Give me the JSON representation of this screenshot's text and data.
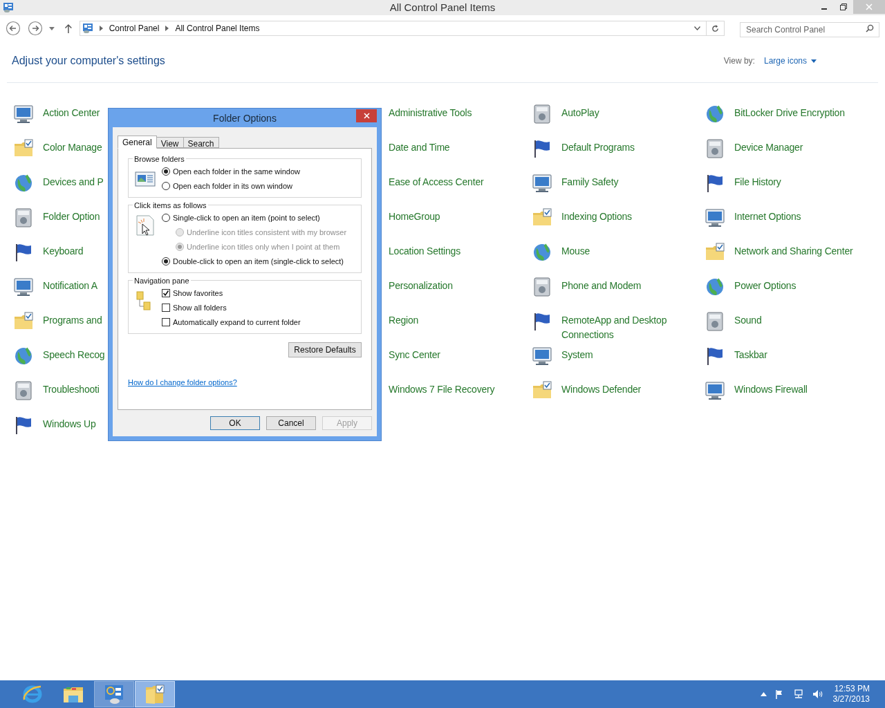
{
  "window": {
    "title": "All Control Panel Items"
  },
  "breadcrumb": [
    "Control Panel",
    "All Control Panel Items"
  ],
  "search": {
    "placeholder": "Search Control Panel"
  },
  "heading": "Adjust your computer's settings",
  "view_by": {
    "label": "View by:",
    "value": "Large icons"
  },
  "items": [
    {
      "label": "Action Center"
    },
    {
      "label": "Administrative Tools"
    },
    {
      "label": "AutoPlay"
    },
    {
      "label": "BitLocker Drive Encryption"
    },
    {
      "label": "Color Manage"
    },
    {
      "label": "Date and Time"
    },
    {
      "label": "Default Programs"
    },
    {
      "label": "Device Manager"
    },
    {
      "label": "Devices and P"
    },
    {
      "label": "Ease of Access Center"
    },
    {
      "label": "Family Safety"
    },
    {
      "label": "File History"
    },
    {
      "label": "Folder Option"
    },
    {
      "label": "HomeGroup"
    },
    {
      "label": "Indexing Options"
    },
    {
      "label": "Internet Options"
    },
    {
      "label": "Keyboard"
    },
    {
      "label": "Location Settings"
    },
    {
      "label": "Mouse"
    },
    {
      "label": "Network and Sharing Center"
    },
    {
      "label": "Notification A"
    },
    {
      "label": "Personalization"
    },
    {
      "label": "Phone and Modem"
    },
    {
      "label": "Power Options"
    },
    {
      "label": "Programs and"
    },
    {
      "label": "Region"
    },
    {
      "label": "RemoteApp and Desktop Connections"
    },
    {
      "label": "Sound"
    },
    {
      "label": "Speech Recog"
    },
    {
      "label": "Sync Center"
    },
    {
      "label": "System"
    },
    {
      "label": "Taskbar"
    },
    {
      "label": "Troubleshooti"
    },
    {
      "label": "Windows 7 File Recovery"
    },
    {
      "label": "Windows Defender"
    },
    {
      "label": "Windows Firewall"
    },
    {
      "label": "Windows Up"
    }
  ],
  "dialog": {
    "title": "Folder Options",
    "tabs": [
      {
        "label": "General",
        "selected": true
      },
      {
        "label": "View",
        "selected": false
      },
      {
        "label": "Search",
        "selected": false
      }
    ],
    "browse_folders": {
      "title": "Browse folders",
      "options": [
        {
          "label": "Open each folder in the same window",
          "selected": true,
          "disabled": false
        },
        {
          "label": "Open each folder in its own window",
          "selected": false,
          "disabled": false
        }
      ]
    },
    "click_items": {
      "title": "Click items as follows",
      "options": [
        {
          "label": "Single-click to open an item (point to select)",
          "selected": false,
          "disabled": false,
          "children": [
            {
              "label": "Underline icon titles consistent with my browser",
              "selected": false,
              "disabled": true
            },
            {
              "label": "Underline icon titles only when I point at them",
              "selected": true,
              "disabled": true
            }
          ]
        },
        {
          "label": "Double-click to open an item (single-click to select)",
          "selected": true,
          "disabled": false
        }
      ]
    },
    "navigation_pane": {
      "title": "Navigation pane",
      "options": [
        {
          "label": "Show favorites",
          "checked": true
        },
        {
          "label": "Show all folders",
          "checked": false
        },
        {
          "label": "Automatically expand to current folder",
          "checked": false
        }
      ]
    },
    "restore_button": "Restore Defaults",
    "help_link": "How do I change folder options?",
    "buttons": [
      {
        "label": "OK",
        "disabled": false,
        "default": true
      },
      {
        "label": "Cancel",
        "disabled": false,
        "default": false
      },
      {
        "label": "Apply",
        "disabled": true,
        "default": false
      }
    ]
  },
  "taskbar": {
    "apps": [
      {
        "kind": "browser",
        "active": false
      },
      {
        "kind": "explorer",
        "active": false
      },
      {
        "kind": "control-panel",
        "active": true
      },
      {
        "kind": "folder-options",
        "active": true
      }
    ],
    "clock": {
      "time": "12:53 PM",
      "date": "3/27/2013"
    }
  }
}
